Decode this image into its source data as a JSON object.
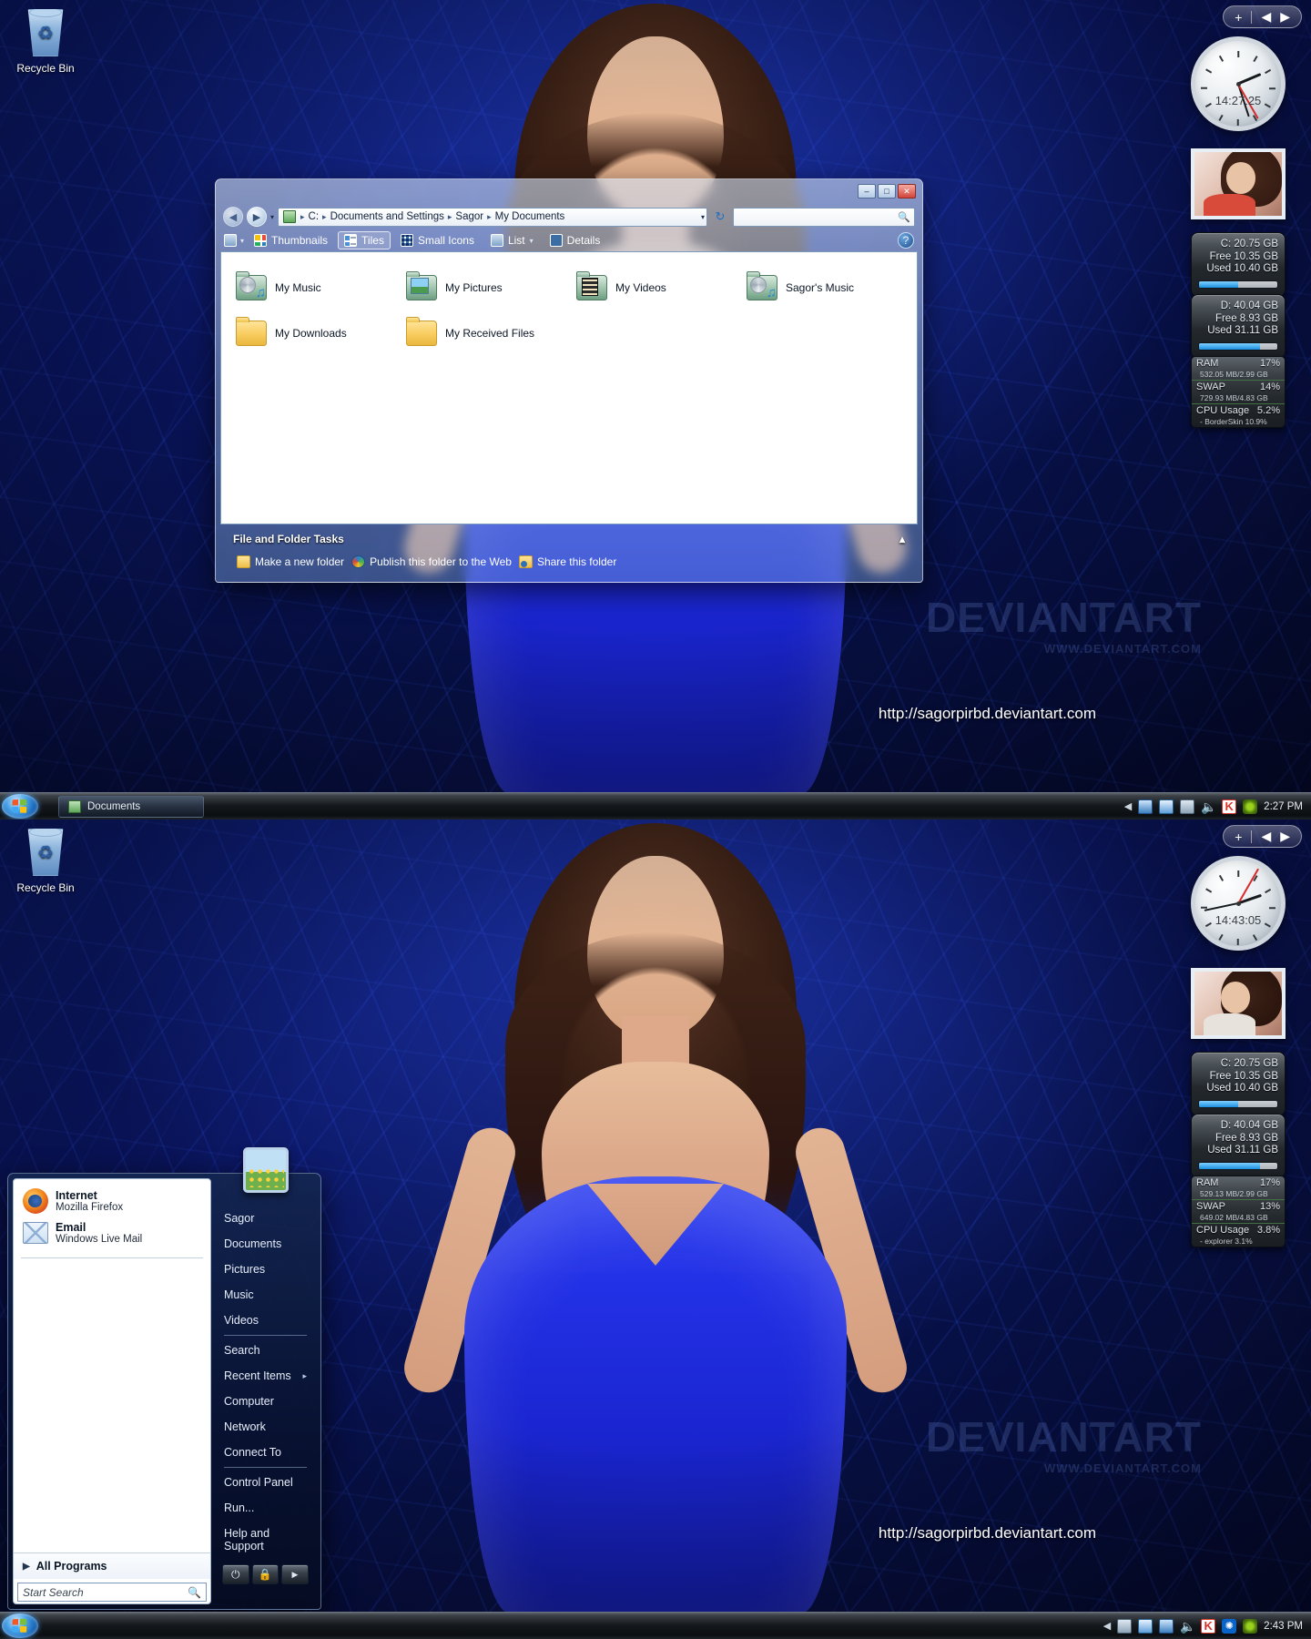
{
  "desktop_icons": [
    {
      "label": "Recycle Bin",
      "icon": "recycle-bin-icon"
    }
  ],
  "wallpaper": {
    "site_url": "http://sagorpirbd.deviantart.com",
    "watermark": "DEVIANTART",
    "watermark_sub": "WWW.DEVIANTART.COM"
  },
  "sidebar_controls": {
    "add": "+",
    "prev": "◀",
    "next": "▶"
  },
  "top": {
    "clock": {
      "time_text": "14:27:25",
      "hours": 14,
      "minutes": 27,
      "seconds": 25
    },
    "photo_gadget": "photo-gadget",
    "disks": [
      {
        "name": "drive-c",
        "title": "C:  20.75 GB",
        "free": "Free 10.35 GB",
        "used": "Used 10.40 GB",
        "percent": 50
      },
      {
        "name": "drive-d",
        "title": "D:  40.04 GB",
        "free": "Free 8.93 GB",
        "used": "Used 31.11 GB",
        "percent": 78
      }
    ],
    "resources": {
      "ram_label": "RAM",
      "ram_pct": "17%",
      "ram_detail": "532.05 MB/2.99 GB",
      "swap_label": "SWAP",
      "swap_pct": "14%",
      "swap_detail": "729.93 MB/4.83 GB",
      "cpu_label": "CPU Usage",
      "cpu_pct": "5.2%",
      "cpu_detail": "- BorderSkin 10.9%"
    },
    "taskbar": {
      "task_label": "Documents",
      "clock": "2:27 PM"
    }
  },
  "bottom": {
    "clock": {
      "time_text": "14:43:05",
      "hours": 14,
      "minutes": 43,
      "seconds": 5
    },
    "photo_gadget": "photo-gadget",
    "disks": [
      {
        "name": "drive-c",
        "title": "C:  20.75 GB",
        "free": "Free 10.35 GB",
        "used": "Used 10.40 GB",
        "percent": 50
      },
      {
        "name": "drive-d",
        "title": "D:  40.04 GB",
        "free": "Free 8.93 GB",
        "used": "Used 31.11 GB",
        "percent": 78
      }
    ],
    "resources": {
      "ram_label": "RAM",
      "ram_pct": "17%",
      "ram_detail": "529.13 MB/2.99 GB",
      "swap_label": "SWAP",
      "swap_pct": "13%",
      "swap_detail": "649.02 MB/4.83 GB",
      "cpu_label": "CPU Usage",
      "cpu_pct": "3.8%",
      "cpu_detail": "- explorer 3.1%"
    },
    "taskbar": {
      "clock": "2:43 PM"
    }
  },
  "explorer": {
    "window_buttons": {
      "minimize": "–",
      "maximize": "□",
      "close": "✕"
    },
    "nav": {
      "back": "◀",
      "forward": "▶",
      "history": "▾",
      "refresh": "↻",
      "dropdown": "▾"
    },
    "breadcrumbs": [
      "C:",
      "Documents and Settings",
      "Sagor",
      "My Documents"
    ],
    "breadcrumb_separator": "▸",
    "search": {
      "placeholder": "",
      "icon": "search-icon"
    },
    "toolbar": {
      "views_caret": "▾",
      "items": [
        {
          "label": "Thumbnails",
          "icon": "thumbnails-icon",
          "active": false
        },
        {
          "label": "Tiles",
          "icon": "tiles-icon",
          "active": true
        },
        {
          "label": "Small Icons",
          "icon": "small-icons-icon",
          "active": false
        },
        {
          "label": "List",
          "icon": "list-icon",
          "active": false
        },
        {
          "label": "Details",
          "icon": "details-icon",
          "active": false
        }
      ],
      "list_caret": "▾",
      "help": "?"
    },
    "files": [
      {
        "label": "My Music",
        "icon": "music-folder-icon"
      },
      {
        "label": "My Pictures",
        "icon": "pictures-folder-icon"
      },
      {
        "label": "My Videos",
        "icon": "videos-folder-icon"
      },
      {
        "label": "Sagor's Music",
        "icon": "music-folder-icon"
      },
      {
        "label": "My Downloads",
        "icon": "folder-icon"
      },
      {
        "label": "My Received Files",
        "icon": "folder-icon"
      }
    ],
    "tasks": {
      "header": "File and Folder Tasks",
      "collapse": "▴",
      "links": [
        {
          "label": "Make a new folder",
          "icon": "new-folder-icon"
        },
        {
          "label": "Publish this folder to the Web",
          "icon": "publish-web-icon"
        },
        {
          "label": "Share this folder",
          "icon": "share-folder-icon"
        }
      ]
    }
  },
  "start_menu": {
    "pinned": [
      {
        "title": "Internet",
        "subtitle": "Mozilla Firefox",
        "icon": "firefox-icon"
      },
      {
        "title": "Email",
        "subtitle": "Windows Live Mail",
        "icon": "mail-icon"
      }
    ],
    "all_programs": {
      "label": "All Programs",
      "arrow": "▶"
    },
    "search": {
      "placeholder": "Start Search",
      "icon": "search-icon"
    },
    "right_items": [
      {
        "label": "Sagor",
        "arrow": ""
      },
      {
        "label": "Documents",
        "arrow": ""
      },
      {
        "label": "Pictures",
        "arrow": ""
      },
      {
        "label": "Music",
        "arrow": ""
      },
      {
        "label": "Videos",
        "arrow": ""
      },
      {
        "label": "Search",
        "arrow": ""
      },
      {
        "label": "Recent Items",
        "arrow": "▸"
      },
      {
        "label": "Computer",
        "arrow": ""
      },
      {
        "label": "Network",
        "arrow": ""
      },
      {
        "label": "Connect To",
        "arrow": ""
      },
      {
        "label": "Control Panel",
        "arrow": ""
      },
      {
        "label": "Run...",
        "arrow": ""
      },
      {
        "label": "Help and Support",
        "arrow": ""
      }
    ],
    "power": {
      "shutdown": "⏻",
      "lock": "🔒",
      "more": "▶"
    }
  }
}
